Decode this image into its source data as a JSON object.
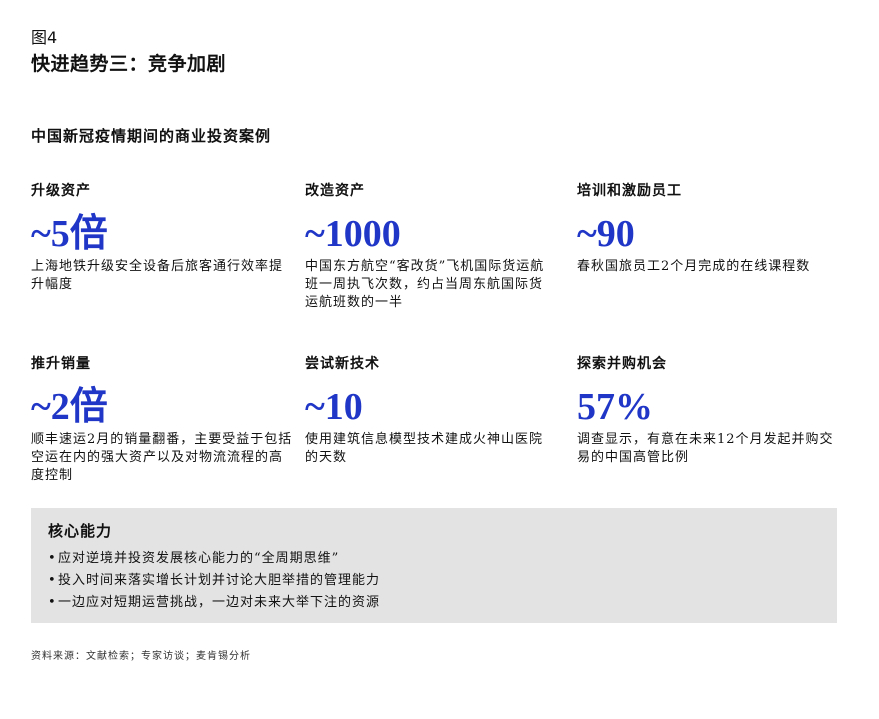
{
  "figure_label": "图4",
  "title": "快进趋势三：竞争加剧",
  "subtitle": "中国新冠疫情期间的商业投资案例",
  "accent_color": "#1f36c7",
  "cases": [
    {
      "category": "升级资产",
      "value": "~5倍",
      "description": "上海地铁升级安全设备后旅客通行效率提升幅度"
    },
    {
      "category": "改造资产",
      "value": "~1000",
      "description": "中国东方航空“客改货”飞机国际货运航班一周执飞次数，约占当周东航国际货运航班数的一半"
    },
    {
      "category": "培训和激励员工",
      "value": "~90",
      "description": "春秋国旅员工2个月完成的在线课程数"
    },
    {
      "category": "推升销量",
      "value": "~2倍",
      "description": "顺丰速运2月的销量翻番，主要受益于包括空运在内的强大资产以及对物流流程的高度控制"
    },
    {
      "category": "尝试新技术",
      "value": "~10",
      "description": "使用建筑信息模型技术建成火神山医院的天数"
    },
    {
      "category": "探索并购机会",
      "value": "57%",
      "description": "调查显示，有意在未来12个月发起并购交易的中国高管比例"
    }
  ],
  "core_capabilities": {
    "title": "核心能力",
    "items": [
      "应对逆境并投资发展核心能力的“全周期思维”",
      "投入时间来落实增长计划并讨论大胆举措的管理能力",
      "一边应对短期运营挑战，一边对未来大举下注的资源"
    ]
  },
  "source": "资料来源：文献检索；专家访谈；麦肯锡分析"
}
